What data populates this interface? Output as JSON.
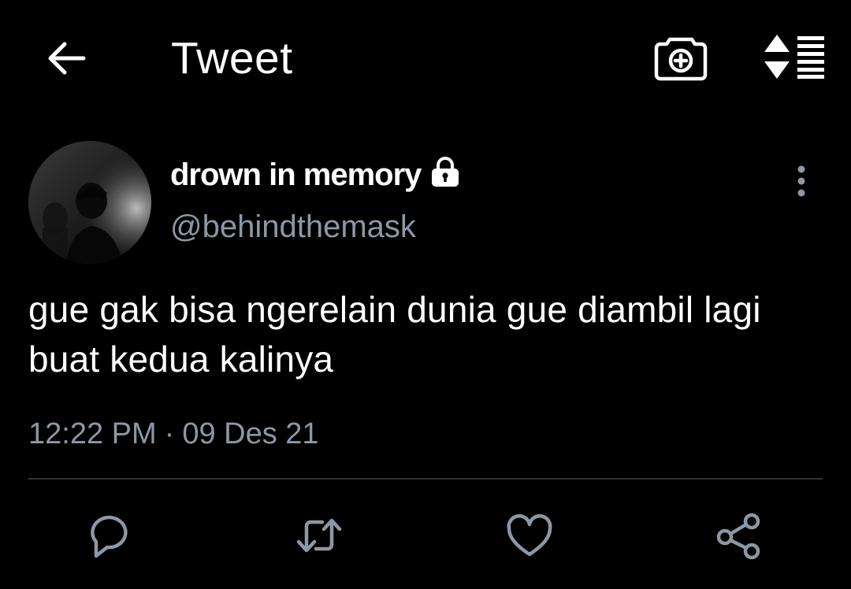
{
  "header": {
    "title": "Tweet",
    "icons": {
      "back": "arrow-left-icon",
      "camera": "camera-plus-icon",
      "sort": "sort-list-icon"
    }
  },
  "tweet": {
    "author": {
      "display_name": "drown in memory",
      "handle": "@behindthemask",
      "protected_icon": "lock-icon"
    },
    "text": "gue gak bisa ngerelain dunia gue diambil lagi buat kedua kalinya",
    "time": "12:22 PM",
    "separator": "·",
    "date": "09 Des 21"
  },
  "actions": {
    "reply": "reply-icon",
    "retweet": "retweet-icon",
    "like": "heart-icon",
    "share": "share-icon"
  },
  "colors": {
    "background": "#000000",
    "text_primary": "#ffffff",
    "text_secondary": "#8b98a5",
    "divider": "#2f3336"
  }
}
